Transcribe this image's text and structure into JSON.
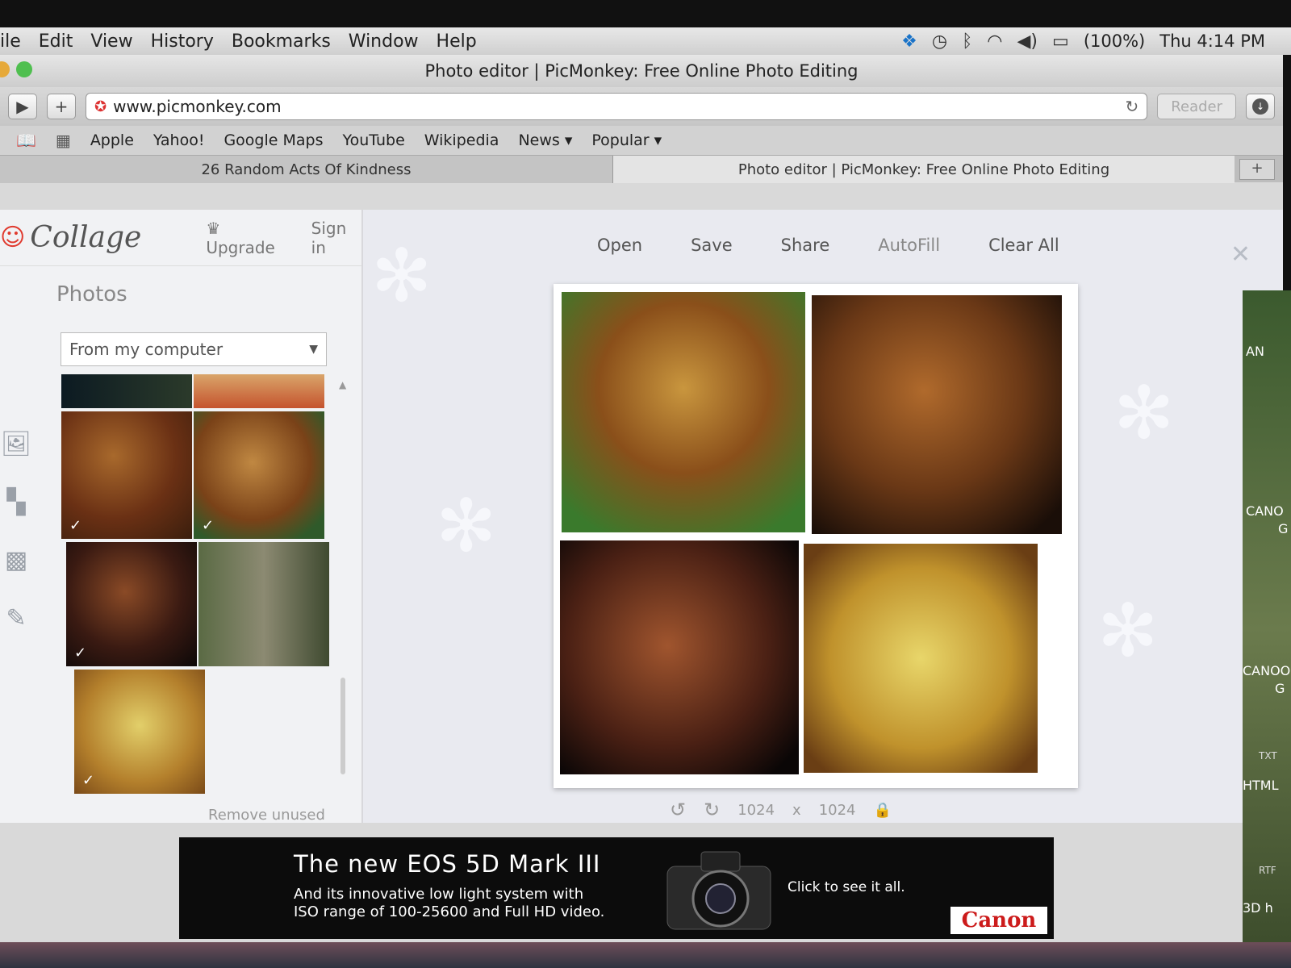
{
  "menubar": {
    "items": [
      "ile",
      "Edit",
      "View",
      "History",
      "Bookmarks",
      "Window",
      "Help"
    ],
    "battery": "(100%)",
    "clock": "Thu 4:14 PM"
  },
  "window": {
    "title": "Photo editor | PicMonkey: Free Online Photo Editing"
  },
  "toolbar": {
    "forward": "▶",
    "add": "+",
    "url": "www.picmonkey.com",
    "reader": "Reader"
  },
  "bookmarks": [
    "Apple",
    "Yahoo!",
    "Google Maps",
    "YouTube",
    "Wikipedia",
    "News ▾",
    "Popular ▾"
  ],
  "tabs": [
    {
      "label": "26 Random Acts Of Kindness"
    },
    {
      "label": "Photo editor | PicMonkey: Free Online Photo Editing"
    }
  ],
  "sidebar": {
    "logo": "Collage",
    "upgrade": "Upgrade",
    "signin": "Sign in",
    "title": "Photos",
    "source": "From my computer",
    "remove_unused": "Remove unused"
  },
  "actions": {
    "open": "Open",
    "save": "Save",
    "share": "Share",
    "autofill": "AutoFill",
    "clear_all": "Clear All"
  },
  "size": {
    "width": "1024",
    "sep": "x",
    "height": "1024"
  },
  "ad": {
    "headline": "The new EOS 5D Mark III",
    "sub1": "And its innovative low light system with",
    "sub2": "ISO range of 100-25600 and Full HD video.",
    "cta": "Click to see it all.",
    "brand": "Canon"
  },
  "desktop": {
    "labels": [
      "AN",
      "CANO",
      "G",
      "CANOO",
      "G",
      "TXT",
      "HTML",
      "RTF",
      "3D h"
    ]
  },
  "colors": {
    "accent_red": "#e03a2e",
    "canvas_bg": "#e9eaf0",
    "link_blue": "#9bb4e8"
  }
}
